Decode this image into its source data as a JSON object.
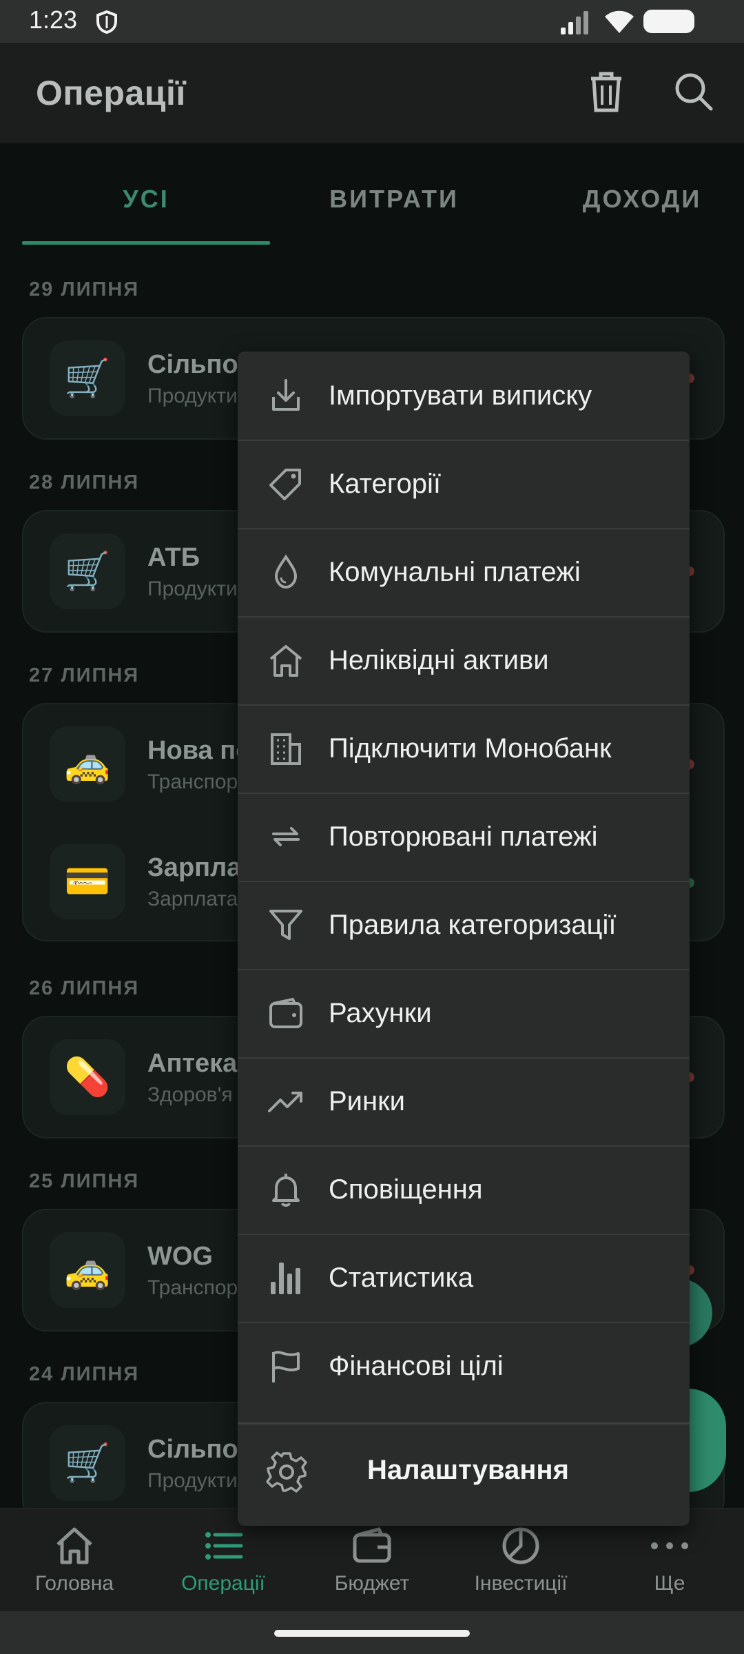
{
  "status_bar": {
    "time": "1:23"
  },
  "app_bar": {
    "title": "Операції"
  },
  "tabs": [
    {
      "label": "УСІ",
      "active": true
    },
    {
      "label": "ВИТРАТИ",
      "active": false
    },
    {
      "label": "ДОХОДИ",
      "active": false
    }
  ],
  "groups": [
    {
      "date": "29 ЛИПНЯ",
      "items": [
        {
          "icon": "🛒",
          "name": "Сільпо",
          "sub": "Продукти"
        }
      ]
    },
    {
      "date": "28 ЛИПНЯ",
      "items": [
        {
          "icon": "🛒",
          "name": "АТБ",
          "sub": "Продукти"
        }
      ]
    },
    {
      "date": "27 ЛИПНЯ",
      "items": [
        {
          "icon": "🚕",
          "name": "Нова по",
          "sub": "Транспор"
        },
        {
          "icon": "💳",
          "name": "Зарпла",
          "sub": "Зарплата"
        }
      ]
    },
    {
      "date": "26 ЛИПНЯ",
      "items": [
        {
          "icon": "💊",
          "name": "Аптека",
          "sub": "Здоров'я"
        }
      ]
    },
    {
      "date": "25 ЛИПНЯ",
      "items": [
        {
          "icon": "🚕",
          "name": "WOG",
          "sub": "Транспор"
        }
      ]
    },
    {
      "date": "24 ЛИПНЯ",
      "items": [
        {
          "icon": "🛒",
          "name": "Сільпо",
          "sub": "Продукти"
        }
      ]
    }
  ],
  "menu": {
    "items": [
      {
        "label": "Імпортувати виписку",
        "icon": "import-icon"
      },
      {
        "label": "Категорії",
        "icon": "tag-icon"
      },
      {
        "label": "Комунальні платежі",
        "icon": "drop-icon"
      },
      {
        "label": "Неліквідні активи",
        "icon": "house-icon"
      },
      {
        "label": "Підключити Монобанк",
        "icon": "building-icon"
      },
      {
        "label": "Повторювані платежі",
        "icon": "repeat-icon"
      },
      {
        "label": "Правила категоризації",
        "icon": "filter-icon"
      },
      {
        "label": "Рахунки",
        "icon": "wallet-icon"
      },
      {
        "label": "Ринки",
        "icon": "trend-icon"
      },
      {
        "label": "Сповіщення",
        "icon": "bell-icon"
      },
      {
        "label": "Статистика",
        "icon": "bar-chart-icon"
      },
      {
        "label": "Фінансові цілі",
        "icon": "flag-icon"
      }
    ],
    "settings_label": "Налаштування"
  },
  "bottom_nav": [
    {
      "label": "Головна",
      "icon": "home-icon",
      "active": false
    },
    {
      "label": "Операції",
      "icon": "list-icon",
      "active": true
    },
    {
      "label": "Бюджет",
      "icon": "wallet-icon",
      "active": false
    },
    {
      "label": "Інвестиції",
      "icon": "pie-icon",
      "active": false
    },
    {
      "label": "Ще",
      "icon": "more-icon",
      "active": false
    }
  ],
  "colors": {
    "accent": "#2f9b78",
    "menu_bg": "#2a2b2b",
    "dim_bg": "#0c110f"
  }
}
